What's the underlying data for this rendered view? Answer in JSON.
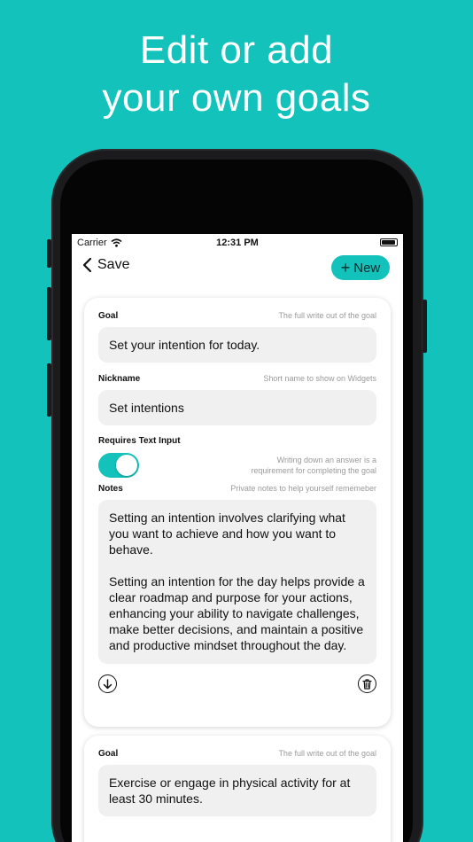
{
  "headline": {
    "line1": "Edit or add",
    "line2": "your own goals"
  },
  "status_bar": {
    "carrier": "Carrier",
    "time": "12:31 PM"
  },
  "nav": {
    "back_label": "Save",
    "new_label": "New",
    "new_icon": "+"
  },
  "colors": {
    "accent": "#12c2bb",
    "background": "#12c2bb",
    "field": "#f0f0f0"
  },
  "goals": [
    {
      "goal_label": "Goal",
      "goal_hint": "The full write out of the goal",
      "goal_value": "Set your intention for today.",
      "nickname_label": "Nickname",
      "nickname_hint": "Short name to show on Widgets",
      "nickname_value": "Set intentions",
      "requires_label": "Requires Text Input",
      "requires_hint": "Writing down an answer is a requirement for completing the goal",
      "requires_on": true,
      "notes_label": "Notes",
      "notes_hint": "Private notes to help yourself rememeber",
      "notes_value": "Setting an intention involves clarifying what you want to achieve and how you want to behave.\n\nSetting an intention for the day helps provide a clear roadmap and purpose for your actions, enhancing your ability to navigate challenges, make better decisions, and maintain a positive and productive mindset throughout the day."
    },
    {
      "goal_label": "Goal",
      "goal_hint": "The full write out of the goal",
      "goal_value": "Exercise or engage in physical activity for at least 30 minutes."
    }
  ],
  "icons": {
    "back": "chevron-left-icon",
    "move_down": "arrow-down-circle-icon",
    "delete": "trash-icon",
    "wifi": "wifi-icon",
    "battery": "battery-icon"
  }
}
